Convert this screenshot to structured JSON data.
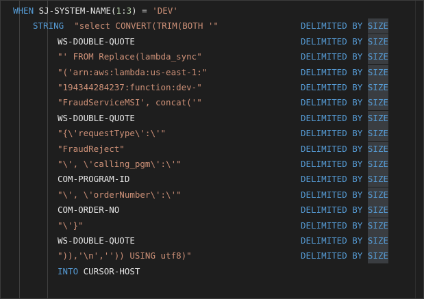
{
  "editor": {
    "lines": [
      {
        "parts": [
          {
            "t": "WHEN",
            "c": "kw"
          },
          {
            "t": " SJ-SYSTEM-NAME(",
            "c": "id"
          },
          {
            "t": "1",
            "c": "num"
          },
          {
            "t": ":",
            "c": "id"
          },
          {
            "t": "3",
            "c": "num"
          },
          {
            "t": ") = ",
            "c": "id"
          },
          {
            "t": "'DEV'",
            "c": "str"
          }
        ],
        "indent": 0,
        "delimited": false
      },
      {
        "parts": [
          {
            "t": "STRING",
            "c": "kw"
          },
          {
            "t": "  \"select CONVERT(TRIM(BOTH '\"",
            "c": "str"
          }
        ],
        "indent": 1,
        "delimited": true
      },
      {
        "parts": [
          {
            "t": "WS-DOUBLE-QUOTE",
            "c": "id"
          }
        ],
        "indent": 2,
        "delimited": true
      },
      {
        "parts": [
          {
            "t": "\"' FROM Replace(lambda_sync\"",
            "c": "str"
          }
        ],
        "indent": 2,
        "delimited": true
      },
      {
        "parts": [
          {
            "t": "\"('arn:aws:lambda:us-east-1:\"",
            "c": "str"
          }
        ],
        "indent": 2,
        "delimited": true
      },
      {
        "parts": [
          {
            "t": "\"194344284237:function:dev-\"",
            "c": "str"
          }
        ],
        "indent": 2,
        "delimited": true
      },
      {
        "parts": [
          {
            "t": "\"FraudServiceMSI', concat('\"",
            "c": "str"
          }
        ],
        "indent": 2,
        "delimited": true
      },
      {
        "parts": [
          {
            "t": "WS-DOUBLE-QUOTE",
            "c": "id"
          }
        ],
        "indent": 2,
        "delimited": true
      },
      {
        "parts": [
          {
            "t": "\"{\\'requestType\\':\\'\"",
            "c": "str"
          }
        ],
        "indent": 2,
        "delimited": true
      },
      {
        "parts": [
          {
            "t": "\"FraudReject\"",
            "c": "str"
          }
        ],
        "indent": 2,
        "delimited": true
      },
      {
        "parts": [
          {
            "t": "\"\\', \\'calling_pgm\\':\\'\"",
            "c": "str"
          }
        ],
        "indent": 2,
        "delimited": true
      },
      {
        "parts": [
          {
            "t": "COM-PROGRAM-ID",
            "c": "id"
          }
        ],
        "indent": 2,
        "delimited": true
      },
      {
        "parts": [
          {
            "t": "\"\\', \\'orderNumber\\':\\'\"",
            "c": "str"
          }
        ],
        "indent": 2,
        "delimited": true
      },
      {
        "parts": [
          {
            "t": "COM-ORDER-NO",
            "c": "id"
          }
        ],
        "indent": 2,
        "delimited": true
      },
      {
        "parts": [
          {
            "t": "\"\\'}\"",
            "c": "str"
          }
        ],
        "indent": 2,
        "delimited": true
      },
      {
        "parts": [
          {
            "t": "WS-DOUBLE-QUOTE",
            "c": "id"
          }
        ],
        "indent": 2,
        "delimited": true
      },
      {
        "parts": [
          {
            "t": "\")),'\\n','')) USING utf8)\"",
            "c": "str"
          }
        ],
        "indent": 2,
        "delimited": true
      },
      {
        "parts": [
          {
            "t": "INTO",
            "c": "kw"
          },
          {
            "t": " CURSOR-HOST",
            "c": "id"
          }
        ],
        "indent": 2,
        "delimited": false
      }
    ],
    "delimiter": {
      "delimited": "DELIMITED",
      "by": "BY",
      "size": "SIZE"
    },
    "colors": {
      "background": "#1e1e1e",
      "keyword": "#569cd6",
      "string": "#ce9178",
      "identifier": "#e6e6e6",
      "number": "#b5cea8",
      "selection": "#3a3d41"
    }
  }
}
